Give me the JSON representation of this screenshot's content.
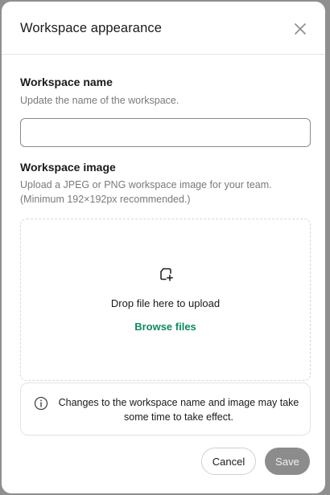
{
  "dialog": {
    "title": "Workspace appearance",
    "close_icon": "close-icon"
  },
  "workspace_name": {
    "label": "Workspace name",
    "hint": "Update the name of the workspace.",
    "value": "",
    "placeholder": ""
  },
  "workspace_image": {
    "label": "Workspace image",
    "hint_line1": "Upload a JPEG or PNG workspace image for your team.",
    "hint_line2": "(Minimum 192×192px recommended.)",
    "dropzone": {
      "icon": "image-add-icon",
      "text": "Drop file here to upload",
      "browse_label": "Browse files"
    }
  },
  "notice": {
    "icon": "info-icon",
    "text": "Changes to the workspace name and image may take some time to take effect."
  },
  "footer": {
    "cancel_label": "Cancel",
    "save_label": "Save"
  },
  "colors": {
    "accent": "#0f8a5f",
    "save_disabled": "#8c8c8c",
    "backdrop": "#8f8f8f"
  }
}
